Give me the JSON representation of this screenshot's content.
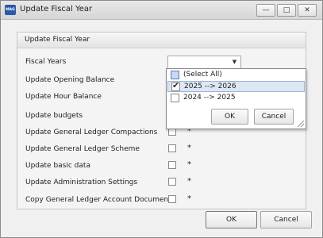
{
  "window": {
    "title": "Update Fiscal Year",
    "icon": "app-logo",
    "app_icon_text": "MAG"
  },
  "controls": {
    "minimize": "—",
    "maximize": "□",
    "close": "✕"
  },
  "group": {
    "title": "Update Fiscal Year",
    "fiscal_years_label": "Fiscal Years",
    "combo_value": "",
    "rows": [
      {
        "label": "Update Opening Balance",
        "checked": false,
        "star": ""
      },
      {
        "label": "Update Hour Balance",
        "checked": false,
        "star": ""
      },
      {
        "label": "Update budgets",
        "checked": false,
        "star": "*"
      },
      {
        "label": "Update General Ledger Compactions",
        "checked": false,
        "star": "*"
      },
      {
        "label": "Update General Ledger Scheme",
        "checked": false,
        "star": "*"
      },
      {
        "label": "Update basic data",
        "checked": false,
        "star": "*"
      },
      {
        "label": "Update Administration Settings",
        "checked": false,
        "star": "*"
      },
      {
        "label": "Copy General Ledger Account Documents",
        "checked": false,
        "star": "*"
      }
    ]
  },
  "dropdown": {
    "items": [
      {
        "label": "(Select All)",
        "state": "indeterminate"
      },
      {
        "label": "2025 --> 2026",
        "state": "checked"
      },
      {
        "label": "2024 --> 2025",
        "state": "unchecked"
      }
    ],
    "ok_label": "OK",
    "cancel_label": "Cancel"
  },
  "footer": {
    "ok_label": "OK",
    "cancel_label": "Cancel"
  }
}
